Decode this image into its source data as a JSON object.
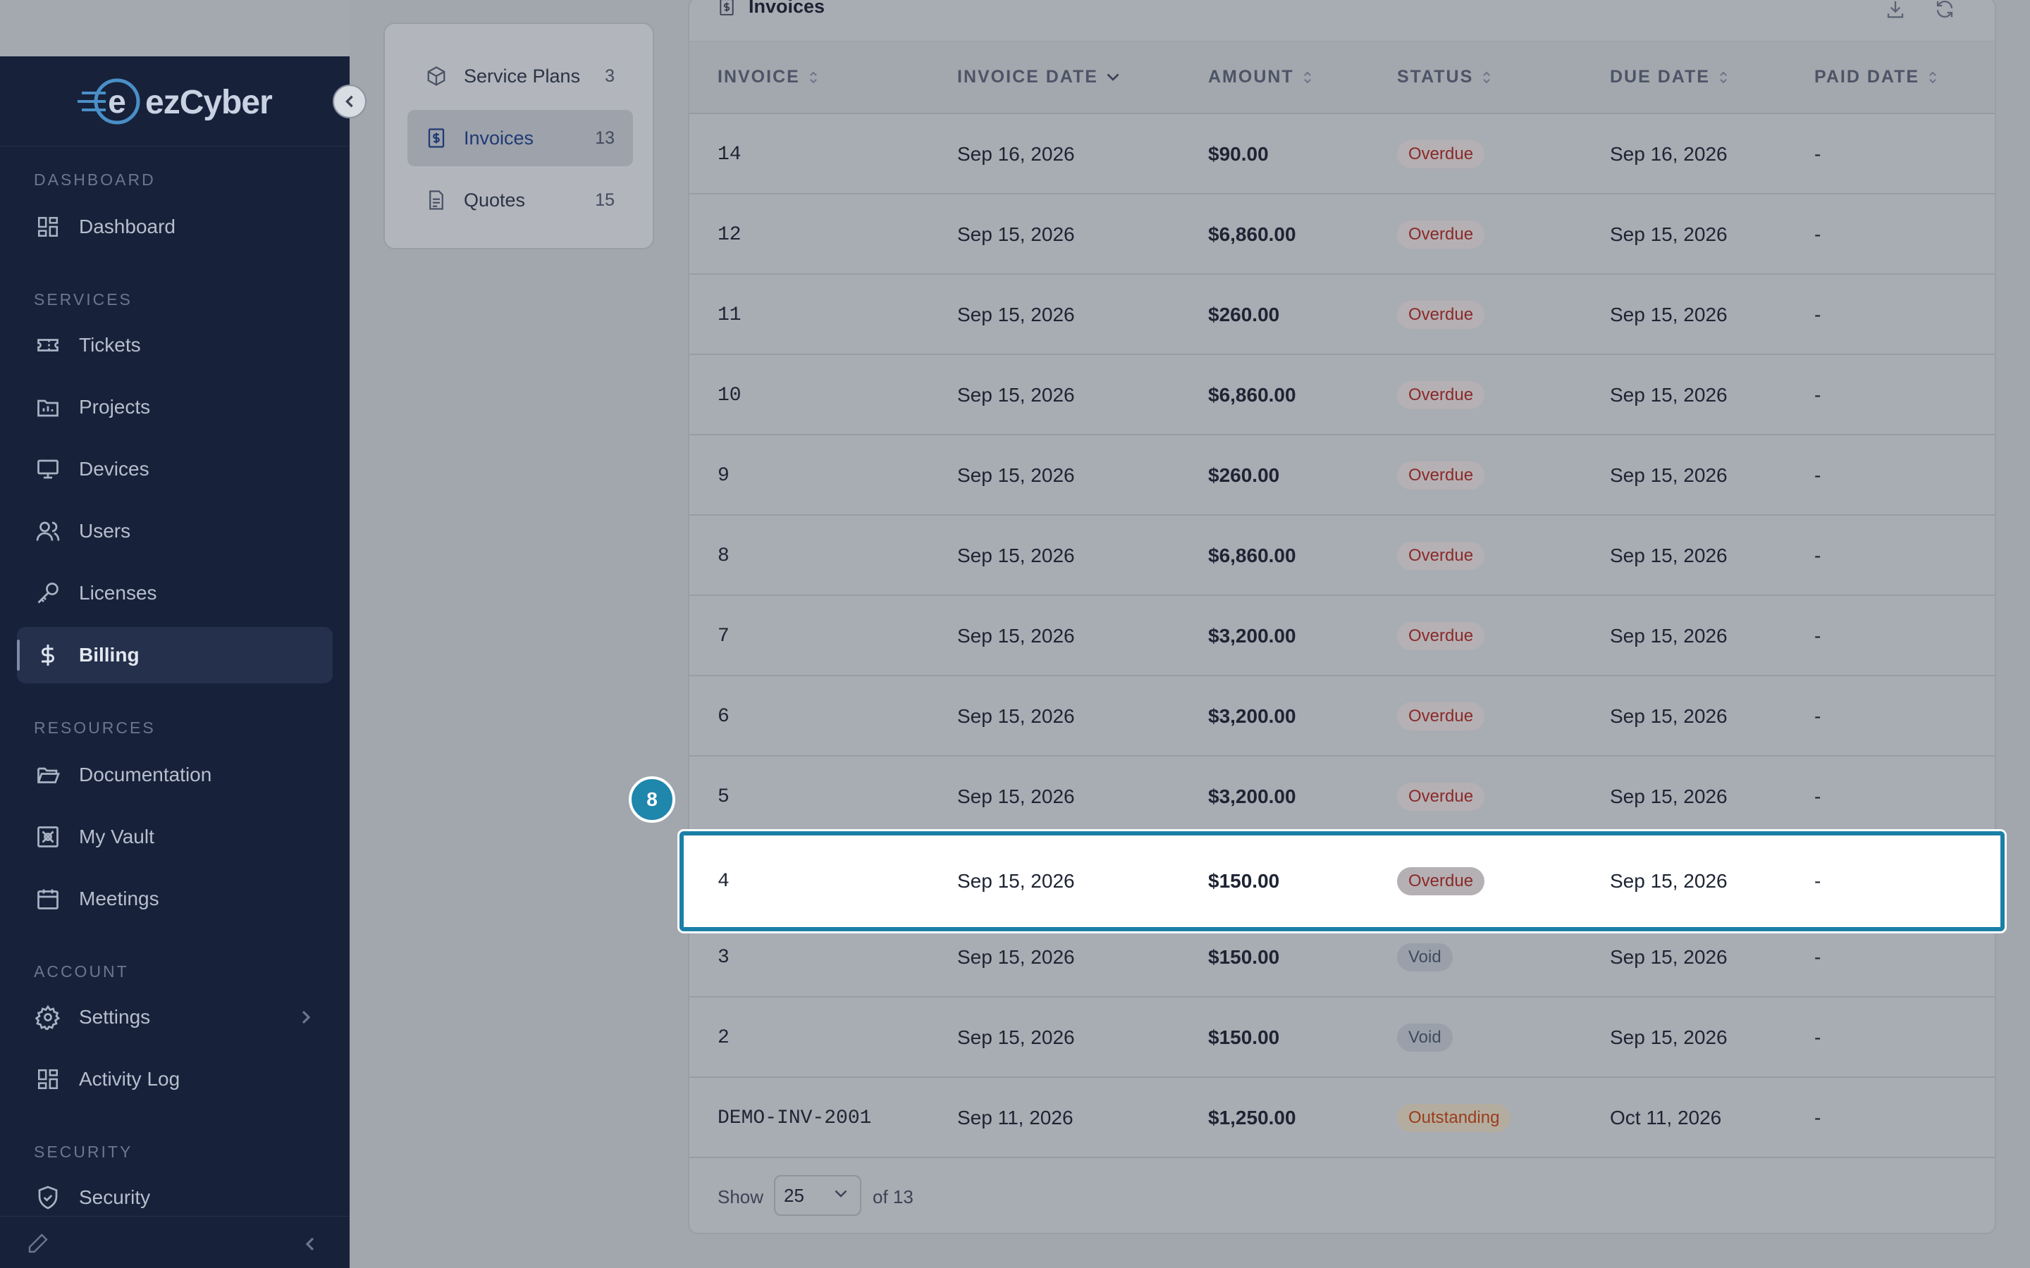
{
  "app": {
    "logo_text": "ezCyber"
  },
  "sidebar": {
    "sections": {
      "dashboard": "DASHBOARD",
      "services": "SERVICES",
      "resources": "RESOURCES",
      "account": "ACCOUNT",
      "security": "SECURITY"
    },
    "items": [
      {
        "label": "Dashboard",
        "icon": "grid-icon"
      },
      {
        "label": "Tickets",
        "icon": "ticket-icon"
      },
      {
        "label": "Projects",
        "icon": "folder-chart-icon"
      },
      {
        "label": "Devices",
        "icon": "monitor-icon"
      },
      {
        "label": "Users",
        "icon": "users-icon"
      },
      {
        "label": "Licenses",
        "icon": "key-icon"
      },
      {
        "label": "Billing",
        "icon": "dollar-icon",
        "active": true
      },
      {
        "label": "Documentation",
        "icon": "folder-open-icon"
      },
      {
        "label": "My Vault",
        "icon": "vault-icon"
      },
      {
        "label": "Meetings",
        "icon": "calendar-icon"
      },
      {
        "label": "Settings",
        "icon": "gear-icon"
      },
      {
        "label": "Activity Log",
        "icon": "grid-icon"
      },
      {
        "label": "Security",
        "icon": "shield-icon"
      }
    ]
  },
  "subnav": {
    "items": [
      {
        "label": "Service Plans",
        "count": "3",
        "icon": "box-icon"
      },
      {
        "label": "Invoices",
        "count": "13",
        "icon": "invoice-icon",
        "active": true
      },
      {
        "label": "Quotes",
        "count": "15",
        "icon": "document-icon"
      }
    ]
  },
  "panel": {
    "title": "Invoices",
    "columns": [
      "INVOICE",
      "INVOICE DATE",
      "AMOUNT",
      "STATUS",
      "DUE DATE",
      "PAID DATE"
    ],
    "rows": [
      {
        "invoice": "14",
        "invoice_date": "Sep 16, 2026",
        "amount": "$90.00",
        "status": "Overdue",
        "due_date": "Sep 16, 2026",
        "paid_date": "-"
      },
      {
        "invoice": "12",
        "invoice_date": "Sep 15, 2026",
        "amount": "$6,860.00",
        "status": "Overdue",
        "due_date": "Sep 15, 2026",
        "paid_date": "-"
      },
      {
        "invoice": "11",
        "invoice_date": "Sep 15, 2026",
        "amount": "$260.00",
        "status": "Overdue",
        "due_date": "Sep 15, 2026",
        "paid_date": "-"
      },
      {
        "invoice": "10",
        "invoice_date": "Sep 15, 2026",
        "amount": "$6,860.00",
        "status": "Overdue",
        "due_date": "Sep 15, 2026",
        "paid_date": "-"
      },
      {
        "invoice": "9",
        "invoice_date": "Sep 15, 2026",
        "amount": "$260.00",
        "status": "Overdue",
        "due_date": "Sep 15, 2026",
        "paid_date": "-"
      },
      {
        "invoice": "8",
        "invoice_date": "Sep 15, 2026",
        "amount": "$6,860.00",
        "status": "Overdue",
        "due_date": "Sep 15, 2026",
        "paid_date": "-"
      },
      {
        "invoice": "7",
        "invoice_date": "Sep 15, 2026",
        "amount": "$3,200.00",
        "status": "Overdue",
        "due_date": "Sep 15, 2026",
        "paid_date": "-"
      },
      {
        "invoice": "6",
        "invoice_date": "Sep 15, 2026",
        "amount": "$3,200.00",
        "status": "Overdue",
        "due_date": "Sep 15, 2026",
        "paid_date": "-"
      },
      {
        "invoice": "5",
        "invoice_date": "Sep 15, 2026",
        "amount": "$3,200.00",
        "status": "Overdue",
        "due_date": "Sep 15, 2026",
        "paid_date": "-"
      },
      {
        "invoice": "4",
        "invoice_date": "Sep 15, 2026",
        "amount": "$150.00",
        "status": "Overdue",
        "due_date": "Sep 15, 2026",
        "paid_date": "-",
        "highlighted": true
      },
      {
        "invoice": "3",
        "invoice_date": "Sep 15, 2026",
        "amount": "$150.00",
        "status": "Void",
        "due_date": "Sep 15, 2026",
        "paid_date": "-"
      },
      {
        "invoice": "2",
        "invoice_date": "Sep 15, 2026",
        "amount": "$150.00",
        "status": "Void",
        "due_date": "Sep 15, 2026",
        "paid_date": "-"
      },
      {
        "invoice": "DEMO-INV-2001",
        "invoice_date": "Sep 11, 2026",
        "amount": "$1,250.00",
        "status": "Outstanding",
        "due_date": "Oct 11, 2026",
        "paid_date": "-"
      }
    ],
    "footer": {
      "show_label": "Show",
      "page_size": "25",
      "of_label": "of 13"
    }
  },
  "step_marker": "8",
  "colors": {
    "sidebar_bg": "#17213a",
    "highlight_border": "#1b7fa6",
    "overdue_text": "#8a2a2a",
    "outstanding_text": "#9a3c1c"
  }
}
